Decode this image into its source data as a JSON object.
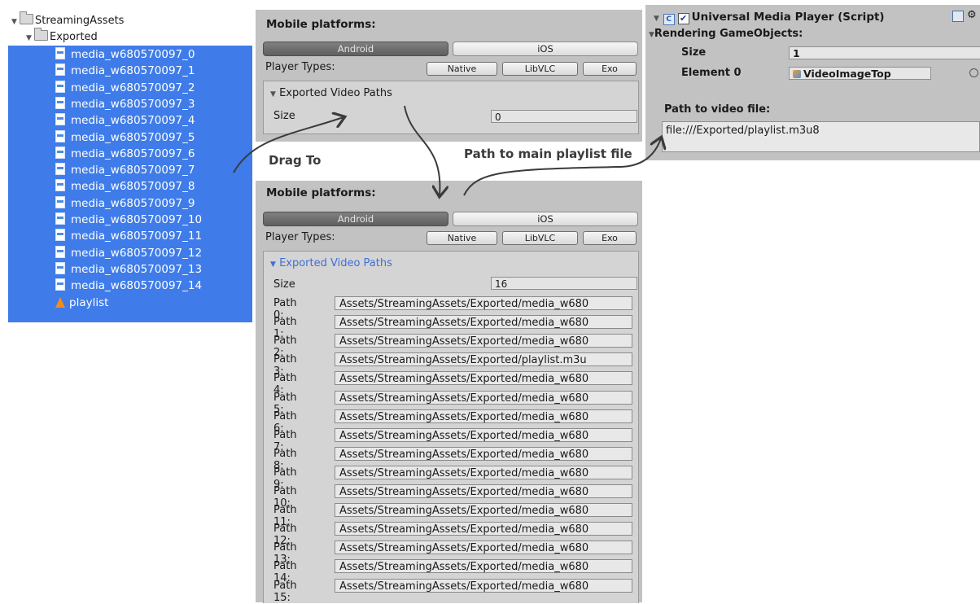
{
  "tree": {
    "root": "StreamingAssets",
    "folder": "Exported",
    "files": [
      "media_w680570097_0",
      "media_w680570097_1",
      "media_w680570097_2",
      "media_w680570097_3",
      "media_w680570097_4",
      "media_w680570097_5",
      "media_w680570097_6",
      "media_w680570097_7",
      "media_w680570097_8",
      "media_w680570097_9",
      "media_w680570097_10",
      "media_w680570097_11",
      "media_w680570097_12",
      "media_w680570097_13",
      "media_w680570097_14"
    ],
    "playlist": "playlist"
  },
  "mobile_panel_before": {
    "title": "Mobile platforms:",
    "tabs": [
      "Android",
      "iOS"
    ],
    "selected_tab": "Android",
    "player_types_label": "Player Types:",
    "player_types": [
      "Native",
      "LibVLC",
      "Exo"
    ],
    "paths_header": "Exported Video Paths",
    "size_label": "Size",
    "size_value": "0"
  },
  "mobile_panel_after": {
    "title": "Mobile platforms:",
    "tabs": [
      "Android",
      "iOS"
    ],
    "selected_tab": "Android",
    "player_types_label": "Player Types:",
    "player_types": [
      "Native",
      "LibVLC",
      "Exo"
    ],
    "paths_header": "Exported Video Paths",
    "size_label": "Size",
    "size_value": "16",
    "paths": [
      {
        "label": "Path 0:",
        "value": "Assets/StreamingAssets/Exported/media_w680"
      },
      {
        "label": "Path 1:",
        "value": "Assets/StreamingAssets/Exported/media_w680"
      },
      {
        "label": "Path 2:",
        "value": "Assets/StreamingAssets/Exported/media_w680"
      },
      {
        "label": "Path 3:",
        "value": "Assets/StreamingAssets/Exported/playlist.m3u"
      },
      {
        "label": "Path 4:",
        "value": "Assets/StreamingAssets/Exported/media_w680"
      },
      {
        "label": "Path 5:",
        "value": "Assets/StreamingAssets/Exported/media_w680"
      },
      {
        "label": "Path 6:",
        "value": "Assets/StreamingAssets/Exported/media_w680"
      },
      {
        "label": "Path 7:",
        "value": "Assets/StreamingAssets/Exported/media_w680"
      },
      {
        "label": "Path 8:",
        "value": "Assets/StreamingAssets/Exported/media_w680"
      },
      {
        "label": "Path 9:",
        "value": "Assets/StreamingAssets/Exported/media_w680"
      },
      {
        "label": "Path 10:",
        "value": "Assets/StreamingAssets/Exported/media_w680"
      },
      {
        "label": "Path 11:",
        "value": "Assets/StreamingAssets/Exported/media_w680"
      },
      {
        "label": "Path 12:",
        "value": "Assets/StreamingAssets/Exported/media_w680"
      },
      {
        "label": "Path 13:",
        "value": "Assets/StreamingAssets/Exported/media_w680"
      },
      {
        "label": "Path 14:",
        "value": "Assets/StreamingAssets/Exported/media_w680"
      },
      {
        "label": "Path 15:",
        "value": "Assets/StreamingAssets/Exported/media_w680"
      }
    ]
  },
  "inspector": {
    "component_title": "Universal Media Player (Script)",
    "rendering_label": "Rendering GameObjects:",
    "size_label": "Size",
    "size_value": "1",
    "element_label": "Element 0",
    "element_value": "VideoImageTop",
    "path_label": "Path to video file:",
    "path_value": "file:///Exported/playlist.m3u8"
  },
  "annotations": {
    "drag_to": "Drag To",
    "path_note": "Path to main playlist file"
  },
  "colors": {
    "selection": "#3f7ce9",
    "panel_bg": "#c2c2c2",
    "field_bg": "#e8e8e8",
    "expanded_header_blue": "#3f6fd8"
  }
}
